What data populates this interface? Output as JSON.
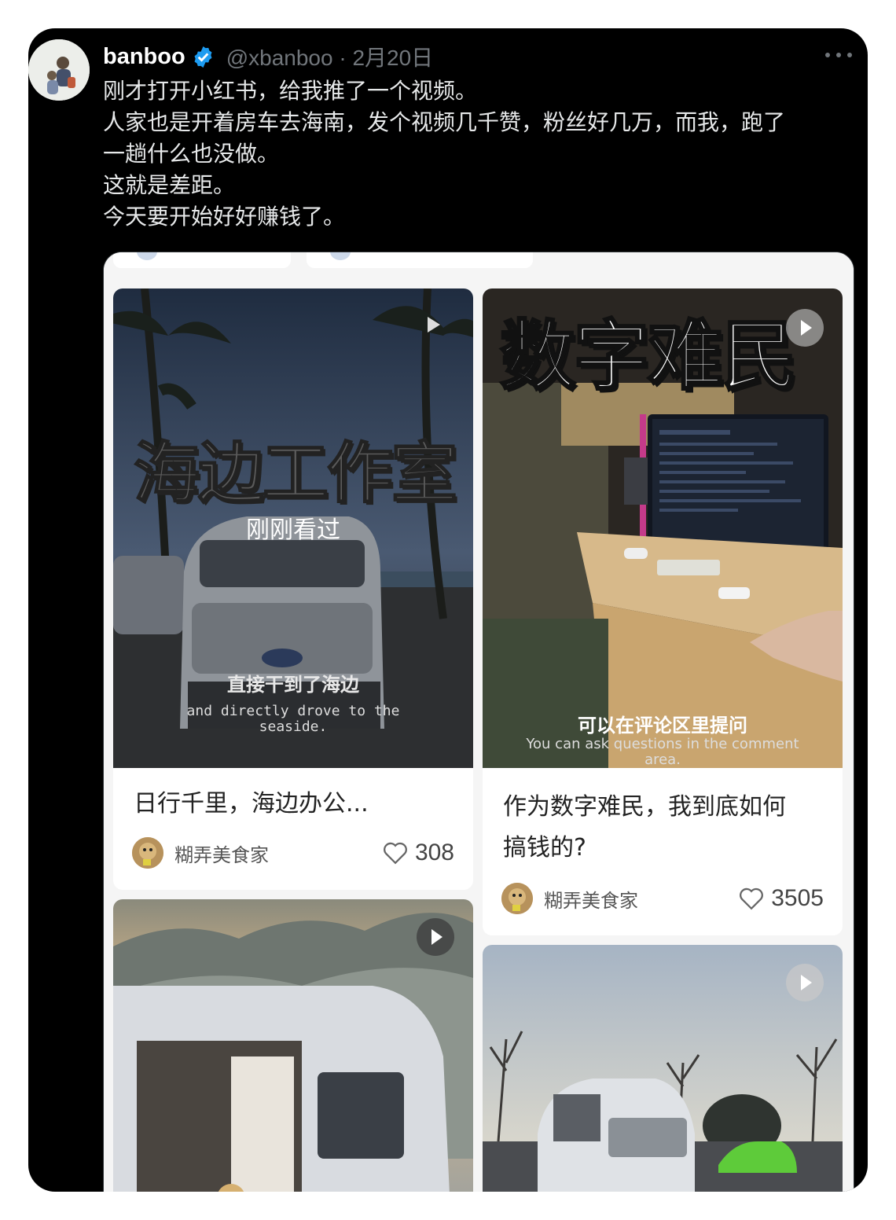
{
  "tweet": {
    "name": "banboo",
    "handle": "@xbanboo · 2月20日",
    "lines": [
      "刚才打开小红书，给我推了一个视频。",
      "人家也是开着房车去海南，发个视频几千赞，粉丝好几万，而我，跑了",
      "一趟什么也没做。",
      "这就是差距。",
      "今天要开始好好赚钱了。"
    ]
  },
  "cards": [
    {
      "overlay_title": "海边工作室",
      "overlay_tag": "刚刚看过",
      "subtitle_zh": "直接干到了海边",
      "subtitle_en_1": "and directly drove to the",
      "subtitle_en_2": "seaside.",
      "title": "日行千里，海边办公...",
      "author": "糊弄美食家",
      "likes": "308"
    },
    {
      "overlay_title": "数字难民",
      "subtitle_zh": "可以在评论区里提问",
      "subtitle_en_1": "You can ask questions in the comment",
      "subtitle_en_2": "area.",
      "title_line1": "作为数字难民，我到底如何",
      "title_line2": "搞钱的?",
      "author": "糊弄美食家",
      "likes": "3505"
    }
  ],
  "colors": {
    "verified": "#1d9bf0",
    "tweet_bg": "#000000",
    "handle": "#71767b"
  }
}
